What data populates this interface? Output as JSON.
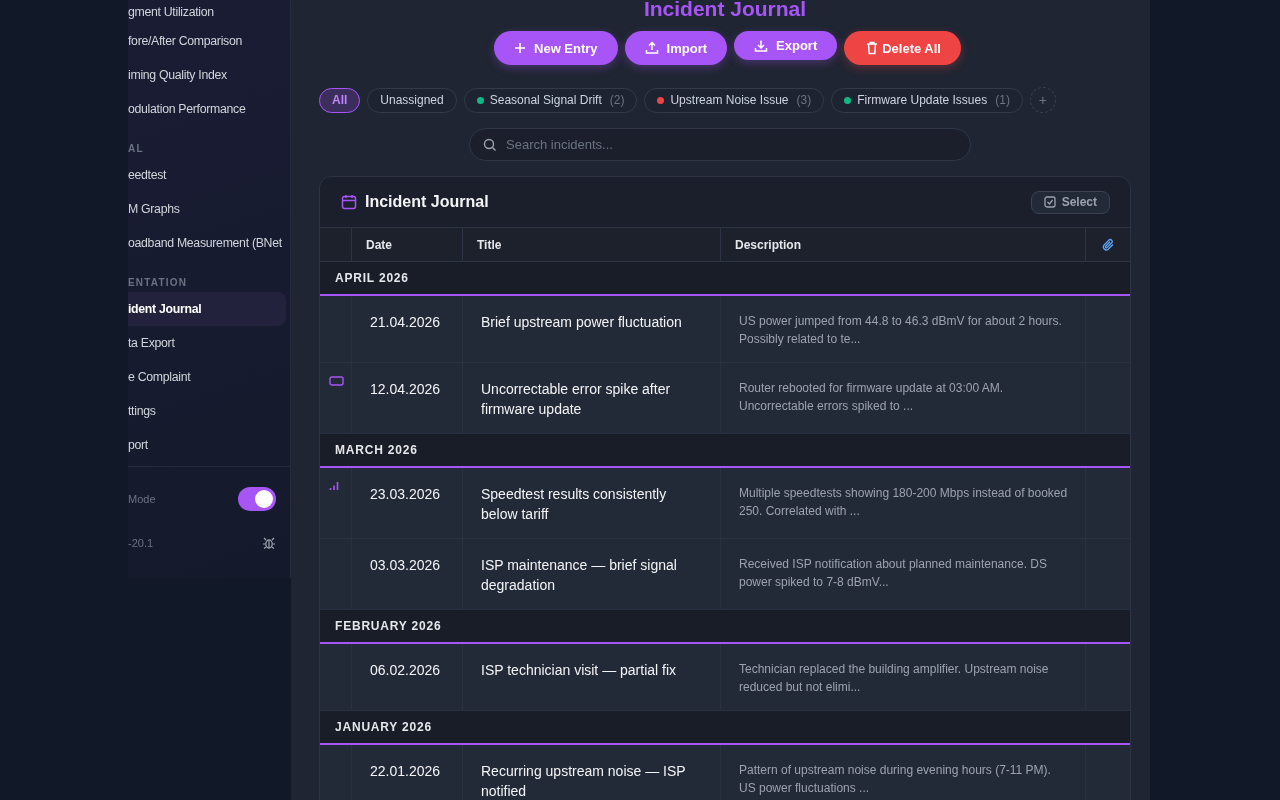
{
  "sidebar": {
    "items": [
      {
        "kind": "item",
        "label": "gment Utilization",
        "selected": false
      },
      {
        "kind": "item",
        "label": "fore/After Comparison",
        "selected": false
      },
      {
        "kind": "item",
        "label": "iming Quality Index",
        "selected": false
      },
      {
        "kind": "item",
        "label": "odulation Performance",
        "selected": false
      },
      {
        "kind": "section",
        "label": "AL"
      },
      {
        "kind": "item",
        "label": "eedtest",
        "selected": false
      },
      {
        "kind": "item",
        "label": "M Graphs",
        "selected": false
      },
      {
        "kind": "item",
        "label": "oadband Measurement (BNet",
        "selected": false
      },
      {
        "kind": "section",
        "label": "ENTATION"
      },
      {
        "kind": "item",
        "label": "ident Journal",
        "selected": true
      },
      {
        "kind": "item",
        "label": "ta Export",
        "selected": false
      },
      {
        "kind": "item",
        "label": "e Complaint",
        "selected": false
      },
      {
        "kind": "item",
        "label": "ttings",
        "selected": false
      },
      {
        "kind": "item",
        "label": "port",
        "selected": false
      }
    ],
    "toggle": {
      "label": "Mode",
      "on": true
    },
    "version": "-20.1"
  },
  "page_title": "Incident Journal",
  "actions": [
    {
      "kind": "add",
      "label": "New Entry"
    },
    {
      "kind": "import",
      "label": "Import"
    },
    {
      "kind": "export",
      "label": "Export"
    },
    {
      "kind": "delete",
      "label": "Delete All"
    }
  ],
  "filters": [
    {
      "label": "All",
      "selected": true
    },
    {
      "label": "Unassigned",
      "selected": false
    },
    {
      "label": "Seasonal Signal Drift",
      "count": "(2)",
      "color": "#10b981",
      "selected": false
    },
    {
      "label": "Upstream Noise Issue",
      "count": "(3)",
      "color": "#ef4444",
      "selected": false
    },
    {
      "label": "Firmware Update Issues",
      "count": "(1)",
      "color": "#10b981",
      "selected": false
    }
  ],
  "add_filter": "+",
  "search": {
    "placeholder": "Search incidents..."
  },
  "card": {
    "title": "Incident Journal",
    "select_button": "Select",
    "columns": [
      "Date",
      "Title",
      "Description"
    ],
    "groups": [
      {
        "month": "APRIL 2026",
        "rows": [
          {
            "kind": "none",
            "date": "21.04.2026",
            "title": "Brief upstream power fluctuation",
            "description": "US power jumped from 44.8 to 46.3 dBmV for about 2 hours. Possibly related to te..."
          },
          {
            "kind": "screen",
            "date": "12.04.2026",
            "title": "Uncorrectable error spike after firmware update",
            "description": "Router rebooted for firmware update at 03:00 AM. Uncorrectable errors spiked to ..."
          }
        ]
      },
      {
        "month": "MARCH 2026",
        "rows": [
          {
            "kind": "bars",
            "date": "23.03.2026",
            "title": "Speedtest results consistently below tariff",
            "description": "Multiple speedtests showing 180-200 Mbps instead of booked 250. Correlated with ..."
          },
          {
            "kind": "none",
            "date": "03.03.2026",
            "title": "ISP maintenance — brief signal degradation",
            "description": "Received ISP notification about planned maintenance. DS power spiked to 7-8 dBmV..."
          }
        ]
      },
      {
        "month": "FEBRUARY 2026",
        "rows": [
          {
            "kind": "none",
            "date": "06.02.2026",
            "title": "ISP technician visit — partial fix",
            "description": "Technician replaced the building amplifier. Upstream noise reduced but not elimi..."
          }
        ]
      },
      {
        "month": "JANUARY 2026",
        "rows": [
          {
            "kind": "none",
            "date": "22.01.2026",
            "title": "Recurring upstream noise — ISP notified",
            "description": "Pattern of upstream noise during evening hours (7-11 PM). US power fluctuations ..."
          }
        ]
      }
    ]
  }
}
